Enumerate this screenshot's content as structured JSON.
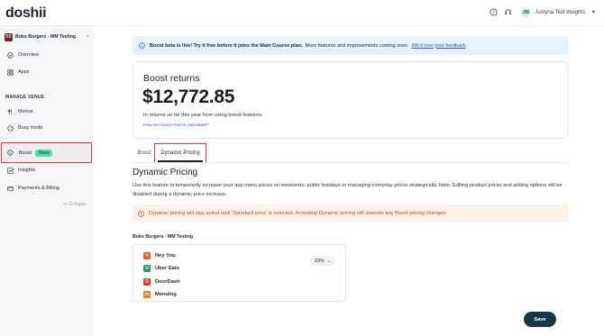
{
  "app": {
    "logo": "doshii"
  },
  "topbar": {
    "help_icon": "help-circle-icon",
    "support_icon": "headset-icon",
    "user": {
      "initials": "JM",
      "name": "Justyna Test Insights",
      "chevron": "▾"
    }
  },
  "sidebar": {
    "venue": {
      "badge": "BB",
      "name": "Bobs Burgers - MM Testing",
      "chevron": "›"
    },
    "items_top": [
      {
        "label": "Overview",
        "icon": "check-circle-icon"
      },
      {
        "label": "Apps",
        "icon": "apps-grid-icon"
      }
    ],
    "section_label": "MANAGE VENUE",
    "items_venue": [
      {
        "label": "Menus",
        "icon": "fork-knife-icon"
      },
      {
        "label": "Busy mode",
        "icon": "gauge-icon"
      }
    ],
    "boost": {
      "label": "Boost",
      "badge": "Beta",
      "icon": "dollar-circle-icon"
    },
    "items_bottom": [
      {
        "label": "Insights",
        "icon": "chart-icon"
      },
      {
        "label": "Payments & Billing",
        "icon": "card-icon"
      }
    ],
    "collapse_label": "⇤ Collapse"
  },
  "banner": {
    "bold": "Boost beta is live! Try it free before it joins the Main Course plan.",
    "text": "More features and improvements coming soon.",
    "link": "We'd love your feedback",
    "end": "."
  },
  "returns_card": {
    "title": "Boost returns",
    "amount": "$12,772.85",
    "subtitle": "In returns so far this year from using boost features.",
    "link": "How are boost returns calculated?"
  },
  "tabs": [
    {
      "label": "Boost"
    },
    {
      "label": "Dynamic Pricing"
    }
  ],
  "dynamic_pricing": {
    "title": "Dynamic Pricing",
    "description": "Use this feature to temporarily increase your app menu prices on weekends, public holidays or managing everyday prices strategically. Note: Editing product prices and adding options will be disabled during a dynamic price increase.",
    "warning": "Dynamic pricing will stay active until 'Standard price' is selected. Activating Dynamic pricing will override any Boost pricing changes.",
    "venue_label": "Bobs Burgers - MM Testing",
    "platforms": [
      {
        "name": "Hey You",
        "color": "#f05a28",
        "letter": "h"
      },
      {
        "name": "Uber Eats",
        "color": "#1f9d55",
        "letter": "U"
      },
      {
        "name": "DoorDash",
        "color": "#e8351f",
        "letter": "D"
      },
      {
        "name": "Menulog",
        "color": "#f07d1a",
        "letter": "m"
      }
    ],
    "increase_value": "20%",
    "increase_chevron": "⌄"
  },
  "actions": {
    "save": "Save"
  },
  "colors": {
    "accent_red": "#e0322f",
    "beta_green": "#4fe0a5",
    "link_blue": "#2a5bd7",
    "save_dark": "#173744",
    "warn_orange": "#c14a1a"
  }
}
